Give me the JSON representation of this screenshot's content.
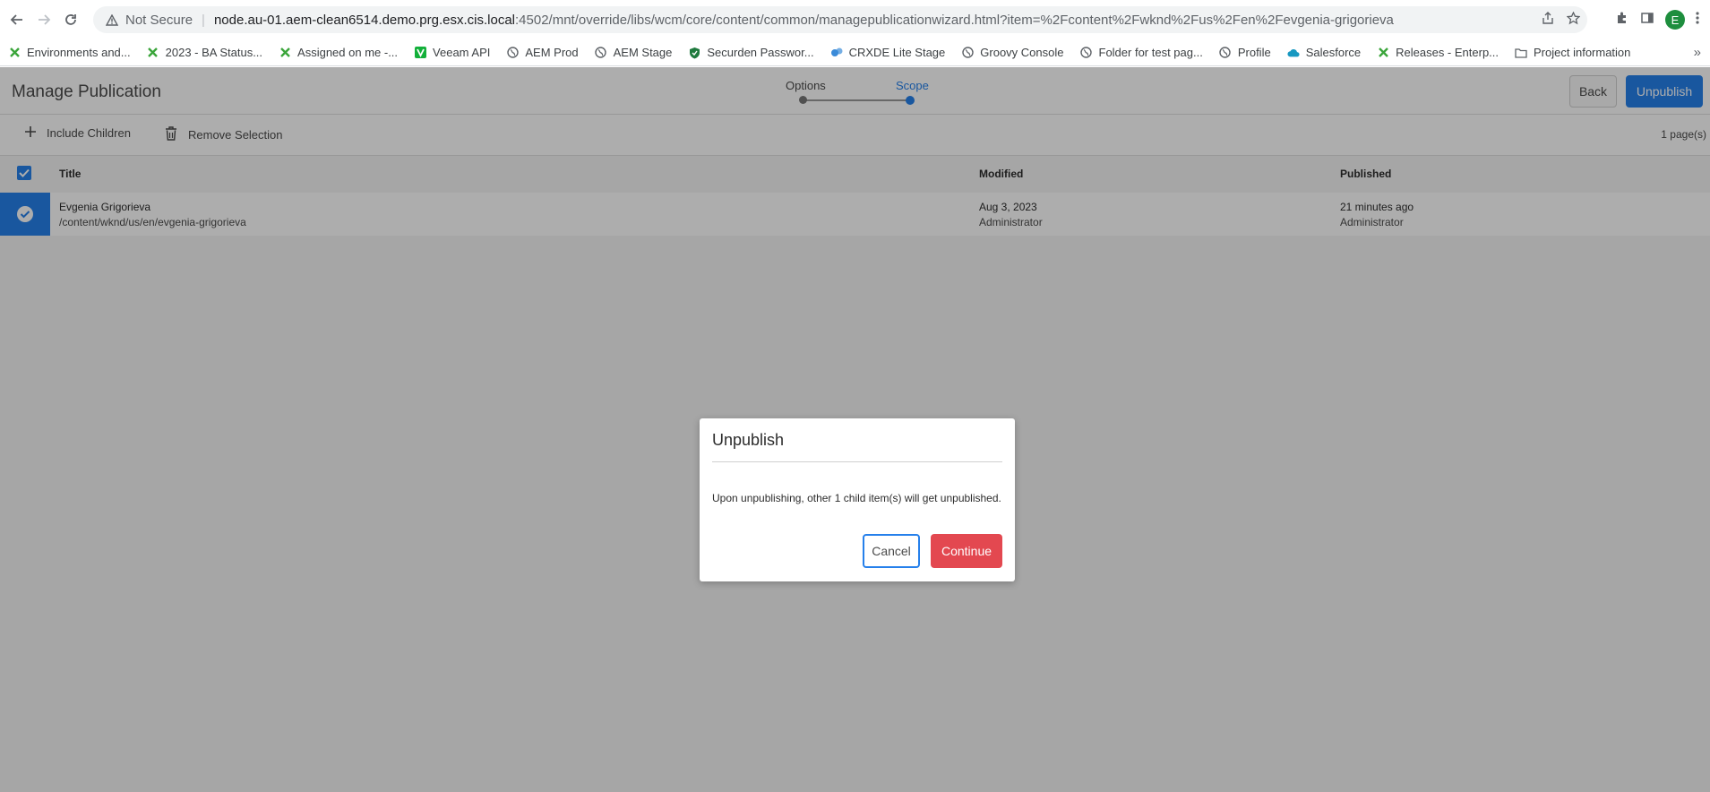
{
  "browser": {
    "not_secure": "Not Secure",
    "url_host": "node.au-01.aem-clean6514.demo.prg.esx.cis.local",
    "url_rest": ":4502/mnt/override/libs/wcm/core/content/common/managepublicationwizard.html?item=%2Fcontent%2Fwknd%2Fus%2Fen%2Fevgenia-grigorieva",
    "profile_initial": "E"
  },
  "bookmarks": [
    {
      "label": "Environments and...",
      "icon": "x-icon",
      "color": "#3aa53a"
    },
    {
      "label": "2023 - BA Status...",
      "icon": "x-icon",
      "color": "#3aa53a"
    },
    {
      "label": "Assigned on me -...",
      "icon": "x-icon",
      "color": "#3aa53a"
    },
    {
      "label": "Veeam API",
      "icon": "v-icon",
      "color": "#13b03a"
    },
    {
      "label": "AEM Prod",
      "icon": "globe-icon",
      "color": "#5f6368"
    },
    {
      "label": "AEM Stage",
      "icon": "globe-icon",
      "color": "#5f6368"
    },
    {
      "label": "Securden Passwor...",
      "icon": "shield-icon",
      "color": "#1f7a3e"
    },
    {
      "label": "CRXDE Lite Stage",
      "icon": "crx-icon",
      "color": "#3b8bd9"
    },
    {
      "label": "Groovy Console",
      "icon": "globe-icon",
      "color": "#5f6368"
    },
    {
      "label": "Folder for test pag...",
      "icon": "globe-icon",
      "color": "#5f6368"
    },
    {
      "label": "Profile",
      "icon": "globe-icon",
      "color": "#5f6368"
    },
    {
      "label": "Salesforce",
      "icon": "cloud-icon",
      "color": "#1798c1"
    },
    {
      "label": "Releases - Enterp...",
      "icon": "x-icon",
      "color": "#3aa53a"
    },
    {
      "label": "Project information",
      "icon": "folder-icon",
      "color": "#5f6368"
    }
  ],
  "app": {
    "title": "Manage Publication",
    "steps": {
      "options": "Options",
      "scope": "Scope"
    },
    "back_label": "Back",
    "unpublish_label": "Unpublish",
    "actions": {
      "include_children": "Include Children",
      "remove_selection": "Remove Selection"
    },
    "page_count": "1 page(s)",
    "columns": {
      "title": "Title",
      "modified": "Modified",
      "published": "Published"
    },
    "rows": [
      {
        "title": "Evgenia Grigorieva",
        "path": "/content/wknd/us/en/evgenia-grigorieva",
        "modified_date": "Aug 3, 2023",
        "modified_by": "Administrator",
        "published_date": "21 minutes ago",
        "published_by": "Administrator"
      }
    ]
  },
  "dialog": {
    "title": "Unpublish",
    "message": "Upon unpublishing, other 1 child item(s) will get unpublished.",
    "cancel_label": "Cancel",
    "continue_label": "Continue"
  },
  "colors": {
    "accent": "#2680eb",
    "danger": "#e34850"
  }
}
